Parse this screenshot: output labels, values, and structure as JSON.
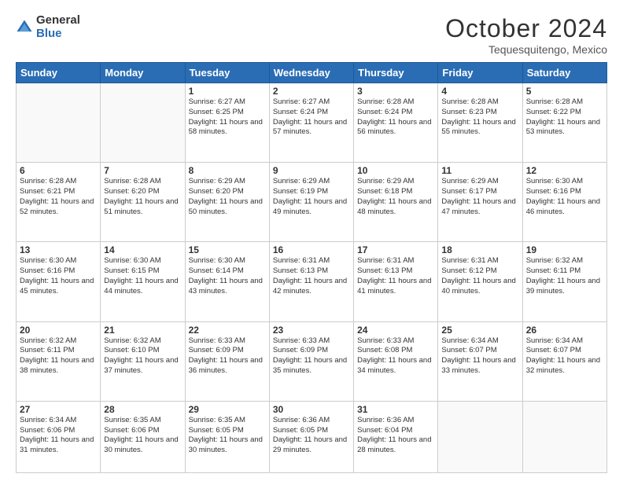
{
  "header": {
    "logo_general": "General",
    "logo_blue": "Blue",
    "month_title": "October 2024",
    "location": "Tequesquitengo, Mexico"
  },
  "days_of_week": [
    "Sunday",
    "Monday",
    "Tuesday",
    "Wednesday",
    "Thursday",
    "Friday",
    "Saturday"
  ],
  "weeks": [
    [
      {
        "day": "",
        "sunrise": "",
        "sunset": "",
        "daylight": "",
        "empty": true
      },
      {
        "day": "",
        "sunrise": "",
        "sunset": "",
        "daylight": "",
        "empty": true
      },
      {
        "day": "1",
        "sunrise": "Sunrise: 6:27 AM",
        "sunset": "Sunset: 6:25 PM",
        "daylight": "Daylight: 11 hours and 58 minutes."
      },
      {
        "day": "2",
        "sunrise": "Sunrise: 6:27 AM",
        "sunset": "Sunset: 6:24 PM",
        "daylight": "Daylight: 11 hours and 57 minutes."
      },
      {
        "day": "3",
        "sunrise": "Sunrise: 6:28 AM",
        "sunset": "Sunset: 6:24 PM",
        "daylight": "Daylight: 11 hours and 56 minutes."
      },
      {
        "day": "4",
        "sunrise": "Sunrise: 6:28 AM",
        "sunset": "Sunset: 6:23 PM",
        "daylight": "Daylight: 11 hours and 55 minutes."
      },
      {
        "day": "5",
        "sunrise": "Sunrise: 6:28 AM",
        "sunset": "Sunset: 6:22 PM",
        "daylight": "Daylight: 11 hours and 53 minutes."
      }
    ],
    [
      {
        "day": "6",
        "sunrise": "Sunrise: 6:28 AM",
        "sunset": "Sunset: 6:21 PM",
        "daylight": "Daylight: 11 hours and 52 minutes."
      },
      {
        "day": "7",
        "sunrise": "Sunrise: 6:28 AM",
        "sunset": "Sunset: 6:20 PM",
        "daylight": "Daylight: 11 hours and 51 minutes."
      },
      {
        "day": "8",
        "sunrise": "Sunrise: 6:29 AM",
        "sunset": "Sunset: 6:20 PM",
        "daylight": "Daylight: 11 hours and 50 minutes."
      },
      {
        "day": "9",
        "sunrise": "Sunrise: 6:29 AM",
        "sunset": "Sunset: 6:19 PM",
        "daylight": "Daylight: 11 hours and 49 minutes."
      },
      {
        "day": "10",
        "sunrise": "Sunrise: 6:29 AM",
        "sunset": "Sunset: 6:18 PM",
        "daylight": "Daylight: 11 hours and 48 minutes."
      },
      {
        "day": "11",
        "sunrise": "Sunrise: 6:29 AM",
        "sunset": "Sunset: 6:17 PM",
        "daylight": "Daylight: 11 hours and 47 minutes."
      },
      {
        "day": "12",
        "sunrise": "Sunrise: 6:30 AM",
        "sunset": "Sunset: 6:16 PM",
        "daylight": "Daylight: 11 hours and 46 minutes."
      }
    ],
    [
      {
        "day": "13",
        "sunrise": "Sunrise: 6:30 AM",
        "sunset": "Sunset: 6:16 PM",
        "daylight": "Daylight: 11 hours and 45 minutes."
      },
      {
        "day": "14",
        "sunrise": "Sunrise: 6:30 AM",
        "sunset": "Sunset: 6:15 PM",
        "daylight": "Daylight: 11 hours and 44 minutes."
      },
      {
        "day": "15",
        "sunrise": "Sunrise: 6:30 AM",
        "sunset": "Sunset: 6:14 PM",
        "daylight": "Daylight: 11 hours and 43 minutes."
      },
      {
        "day": "16",
        "sunrise": "Sunrise: 6:31 AM",
        "sunset": "Sunset: 6:13 PM",
        "daylight": "Daylight: 11 hours and 42 minutes."
      },
      {
        "day": "17",
        "sunrise": "Sunrise: 6:31 AM",
        "sunset": "Sunset: 6:13 PM",
        "daylight": "Daylight: 11 hours and 41 minutes."
      },
      {
        "day": "18",
        "sunrise": "Sunrise: 6:31 AM",
        "sunset": "Sunset: 6:12 PM",
        "daylight": "Daylight: 11 hours and 40 minutes."
      },
      {
        "day": "19",
        "sunrise": "Sunrise: 6:32 AM",
        "sunset": "Sunset: 6:11 PM",
        "daylight": "Daylight: 11 hours and 39 minutes."
      }
    ],
    [
      {
        "day": "20",
        "sunrise": "Sunrise: 6:32 AM",
        "sunset": "Sunset: 6:11 PM",
        "daylight": "Daylight: 11 hours and 38 minutes."
      },
      {
        "day": "21",
        "sunrise": "Sunrise: 6:32 AM",
        "sunset": "Sunset: 6:10 PM",
        "daylight": "Daylight: 11 hours and 37 minutes."
      },
      {
        "day": "22",
        "sunrise": "Sunrise: 6:33 AM",
        "sunset": "Sunset: 6:09 PM",
        "daylight": "Daylight: 11 hours and 36 minutes."
      },
      {
        "day": "23",
        "sunrise": "Sunrise: 6:33 AM",
        "sunset": "Sunset: 6:09 PM",
        "daylight": "Daylight: 11 hours and 35 minutes."
      },
      {
        "day": "24",
        "sunrise": "Sunrise: 6:33 AM",
        "sunset": "Sunset: 6:08 PM",
        "daylight": "Daylight: 11 hours and 34 minutes."
      },
      {
        "day": "25",
        "sunrise": "Sunrise: 6:34 AM",
        "sunset": "Sunset: 6:07 PM",
        "daylight": "Daylight: 11 hours and 33 minutes."
      },
      {
        "day": "26",
        "sunrise": "Sunrise: 6:34 AM",
        "sunset": "Sunset: 6:07 PM",
        "daylight": "Daylight: 11 hours and 32 minutes."
      }
    ],
    [
      {
        "day": "27",
        "sunrise": "Sunrise: 6:34 AM",
        "sunset": "Sunset: 6:06 PM",
        "daylight": "Daylight: 11 hours and 31 minutes."
      },
      {
        "day": "28",
        "sunrise": "Sunrise: 6:35 AM",
        "sunset": "Sunset: 6:06 PM",
        "daylight": "Daylight: 11 hours and 30 minutes."
      },
      {
        "day": "29",
        "sunrise": "Sunrise: 6:35 AM",
        "sunset": "Sunset: 6:05 PM",
        "daylight": "Daylight: 11 hours and 30 minutes."
      },
      {
        "day": "30",
        "sunrise": "Sunrise: 6:36 AM",
        "sunset": "Sunset: 6:05 PM",
        "daylight": "Daylight: 11 hours and 29 minutes."
      },
      {
        "day": "31",
        "sunrise": "Sunrise: 6:36 AM",
        "sunset": "Sunset: 6:04 PM",
        "daylight": "Daylight: 11 hours and 28 minutes."
      },
      {
        "day": "",
        "sunrise": "",
        "sunset": "",
        "daylight": "",
        "empty": true
      },
      {
        "day": "",
        "sunrise": "",
        "sunset": "",
        "daylight": "",
        "empty": true
      }
    ]
  ]
}
